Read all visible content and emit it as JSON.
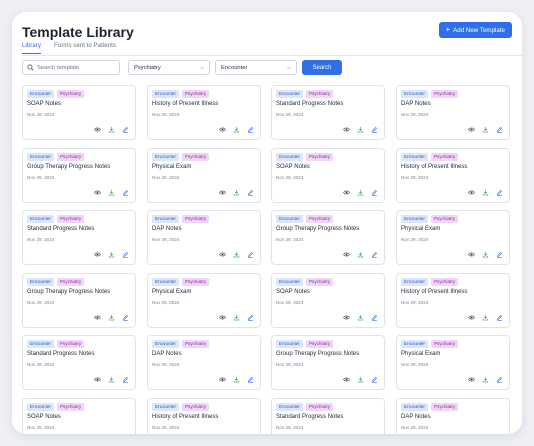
{
  "page": {
    "title": "Template Library",
    "add_button_label": "Add New Template"
  },
  "tabs": [
    {
      "label": "Library",
      "active": true
    },
    {
      "label": "Forms sent to Patients",
      "active": false
    }
  ],
  "filters": {
    "search_placeholder": "Search template",
    "specialty_value": "Psychiatry",
    "type_value": "Encounter",
    "search_button_label": "Search"
  },
  "colors": {
    "accent": "#2f6fe8",
    "encounter_tag": "#dbe6fb",
    "psychiatry_tag": "#f0d6f6",
    "download_icon": "#3aa55a"
  },
  "icons": {
    "view": "eye-icon",
    "download": "download-icon",
    "edit": "edit-icon",
    "search": "search-icon",
    "add": "plus-icon",
    "dropdown": "chevron-down-icon"
  },
  "templates": [
    {
      "tag1": "Encounter",
      "tag2": "Psychiatry",
      "title": "SOAP Notes",
      "date": "Nov 29, 2024"
    },
    {
      "tag1": "Encounter",
      "tag2": "Psychiatry",
      "title": "History of Present Illness",
      "date": "Nov 29, 2024"
    },
    {
      "tag1": "Encounter",
      "tag2": "Psychiatry",
      "title": "Standard Progress Notes",
      "date": "Nov 29, 2024"
    },
    {
      "tag1": "Encounter",
      "tag2": "Psychiatry",
      "title": "DAP Notes",
      "date": "Nov 29, 2024"
    },
    {
      "tag1": "Encounter",
      "tag2": "Psychiatry",
      "title": "Group Therapy Progress Notes",
      "date": "Nov 29, 2024"
    },
    {
      "tag1": "Encounter",
      "tag2": "Psychiatry",
      "title": "Physical Exam",
      "date": "Nov 29, 2024"
    },
    {
      "tag1": "Encounter",
      "tag2": "Psychiatry",
      "title": "SOAP Notes",
      "date": "Nov 29, 2024"
    },
    {
      "tag1": "Encounter",
      "tag2": "Psychiatry",
      "title": "History of Present Illness",
      "date": "Nov 29, 2024"
    },
    {
      "tag1": "Encounter",
      "tag2": "Psychiatry",
      "title": "Standard Progress Notes",
      "date": "Nov 29, 2024"
    },
    {
      "tag1": "Encounter",
      "tag2": "Psychiatry",
      "title": "DAP Notes",
      "date": "Nov 29, 2024"
    },
    {
      "tag1": "Encounter",
      "tag2": "Psychiatry",
      "title": "Group Therapy Progress Notes",
      "date": "Nov 29, 2024"
    },
    {
      "tag1": "Encounter",
      "tag2": "Psychiatry",
      "title": "Physical Exam",
      "date": "Nov 29, 2024"
    },
    {
      "tag1": "Encounter",
      "tag2": "Psychiatry",
      "title": "Group Therapy Progress Notes",
      "date": "Nov 29, 2024"
    },
    {
      "tag1": "Encounter",
      "tag2": "Psychiatry",
      "title": "Physical Exam",
      "date": "Nov 29, 2024"
    },
    {
      "tag1": "Encounter",
      "tag2": "Psychiatry",
      "title": "SOAP Notes",
      "date": "Nov 29, 2024"
    },
    {
      "tag1": "Encounter",
      "tag2": "Psychiatry",
      "title": "History of Present Illness",
      "date": "Nov 29, 2024"
    },
    {
      "tag1": "Encounter",
      "tag2": "Psychiatry",
      "title": "Standard Progress Notes",
      "date": "Nov 29, 2024"
    },
    {
      "tag1": "Encounter",
      "tag2": "Psychiatry",
      "title": "DAP Notes",
      "date": "Nov 29, 2024"
    },
    {
      "tag1": "Encounter",
      "tag2": "Psychiatry",
      "title": "Group Therapy Progress Notes",
      "date": "Nov 29, 2024"
    },
    {
      "tag1": "Encounter",
      "tag2": "Psychiatry",
      "title": "Physical Exam",
      "date": "Nov 29, 2024"
    },
    {
      "tag1": "Encounter",
      "tag2": "Psychiatry",
      "title": "SOAP Notes",
      "date": "Nov 29, 2024"
    },
    {
      "tag1": "Encounter",
      "tag2": "Psychiatry",
      "title": "History of Present Illness",
      "date": "Nov 29, 2024"
    },
    {
      "tag1": "Encounter",
      "tag2": "Psychiatry",
      "title": "Standard Progress Notes",
      "date": "Nov 29, 2024"
    },
    {
      "tag1": "Encounter",
      "tag2": "Psychiatry",
      "title": "DAP Notes",
      "date": "Nov 29, 2024"
    }
  ]
}
